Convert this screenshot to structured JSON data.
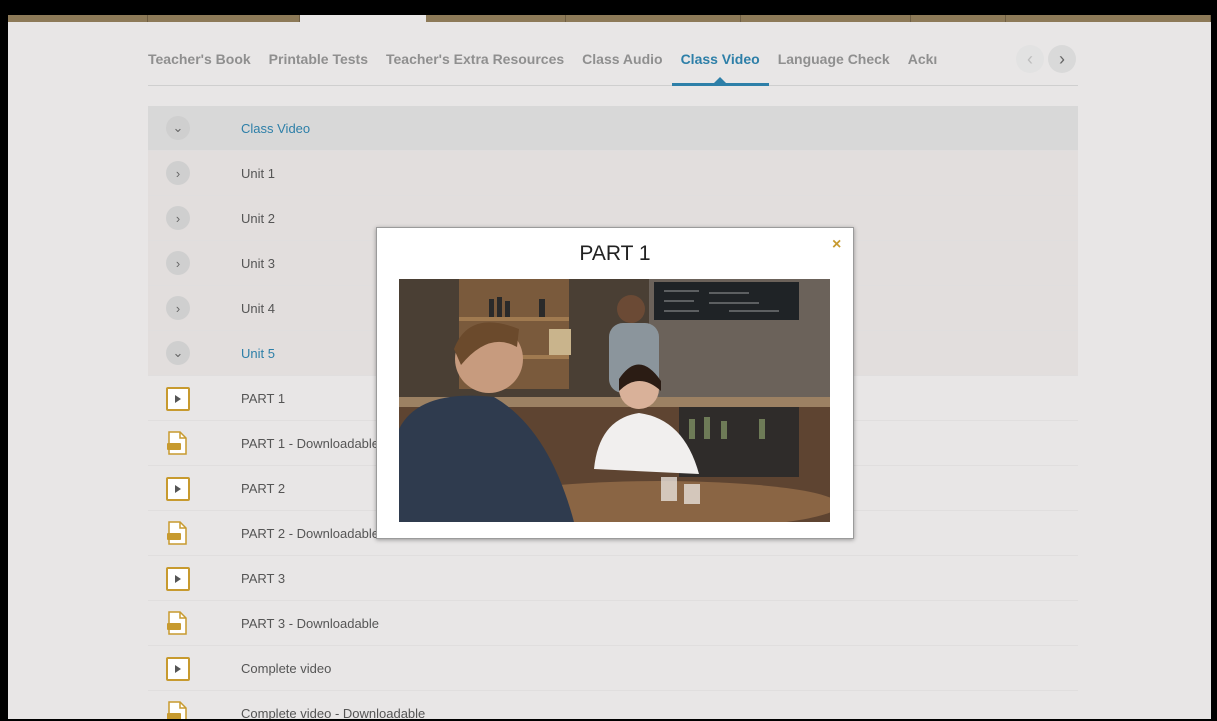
{
  "tabs": [
    {
      "label": "Teacher's Book",
      "active": false
    },
    {
      "label": "Printable Tests",
      "active": false
    },
    {
      "label": "Teacher's Extra Resources",
      "active": false
    },
    {
      "label": "Class Audio",
      "active": false
    },
    {
      "label": "Class Video",
      "active": true
    },
    {
      "label": "Language Check",
      "active": false
    },
    {
      "label": "Ackı",
      "active": false
    }
  ],
  "nav": {
    "prev_icon": "chevron-left-icon",
    "next_icon": "chevron-right-icon"
  },
  "list": {
    "section": "Class Video",
    "units": [
      "Unit 1",
      "Unit 2",
      "Unit 3",
      "Unit 4"
    ],
    "open_unit": "Unit 5",
    "items": [
      {
        "label": "PART 1",
        "type": "video"
      },
      {
        "label": "PART 1 - Downloadable",
        "type": "zip"
      },
      {
        "label": "PART 2",
        "type": "video"
      },
      {
        "label": "PART 2 - Downloadable",
        "type": "zip"
      },
      {
        "label": "PART 3",
        "type": "video"
      },
      {
        "label": "PART 3 - Downloadable",
        "type": "zip"
      },
      {
        "label": "Complete video",
        "type": "video"
      },
      {
        "label": "Complete video - Downloadable",
        "type": "zip"
      }
    ]
  },
  "modal": {
    "title": "PART 1",
    "close": "×"
  },
  "colors": {
    "accent": "#2d7fa8",
    "gold": "#c79a2f",
    "background": "#e8e6e6"
  }
}
